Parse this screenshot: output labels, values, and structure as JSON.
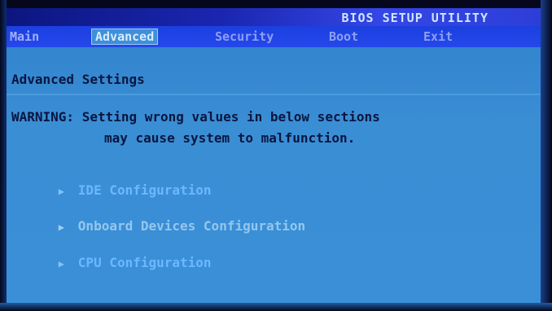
{
  "title_bar": {
    "title": "BIOS SETUP UTILITY"
  },
  "menu": {
    "items": [
      {
        "label": "Main"
      },
      {
        "label": "Advanced",
        "active": true
      },
      {
        "label": "Security"
      },
      {
        "label": "Boot"
      },
      {
        "label": "Exit"
      }
    ]
  },
  "content": {
    "heading": "Advanced Settings",
    "warning_line_1": "WARNING: Setting wrong values in below sections",
    "warning_line_2": "may cause system to malfunction.",
    "submenus": [
      {
        "label": "IDE Configuration",
        "icon": "triangle-right-icon"
      },
      {
        "label": "Onboard Devices Configuration",
        "icon": "triangle-right-icon"
      },
      {
        "label": "CPU Configuration",
        "icon": "triangle-right-icon"
      }
    ]
  },
  "colors": {
    "background": "#3a8ed4",
    "title_bar": "#1a26b0",
    "menu_bar": "#2448ea",
    "text_dark": "#0a1640",
    "link": "#6bb8ff"
  }
}
